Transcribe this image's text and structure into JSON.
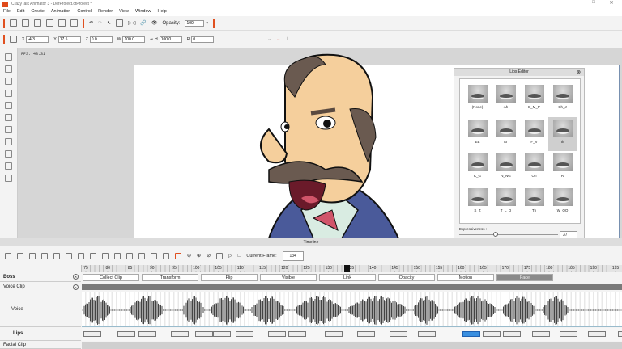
{
  "app": {
    "title": "CrazyTalk Animator 3  - DefProject.ctProject *",
    "fps": "FPS: 43.31"
  },
  "menu": [
    "File",
    "Edit",
    "Create",
    "Animation",
    "Control",
    "Render",
    "View",
    "Window",
    "Help"
  ],
  "toolbar": {
    "opacity_label": "Opacity:",
    "opacity_value": "100"
  },
  "transform": {
    "x_label": "X",
    "x": "-4.3",
    "y_label": "Y",
    "y": "17.5",
    "z_label": "Z",
    "z": "0.0",
    "w_label": "W",
    "w": "100.0",
    "h_label": "H",
    "h": "100.0",
    "r_label": "R",
    "r": "0"
  },
  "lips_editor": {
    "title": "Lips Editor",
    "visemes": [
      "(None)",
      "Ah",
      "B_M_P",
      "Ch_J",
      "EE",
      "Er",
      "F_V",
      "Ih",
      "K_G",
      "N_NG",
      "Oh",
      "R",
      "S_Z",
      "T_L_D",
      "Th",
      "W_OO"
    ],
    "selected": "Ih",
    "expressiveness_label": "Expressiveness :",
    "expressiveness": "37",
    "expressiveness_percent": 37
  },
  "timeline": {
    "title": "Timeline",
    "current_frame_label": "Current Frame:",
    "current_frame": "134",
    "ruler": [
      "75",
      "80",
      "85",
      "90",
      "95",
      "100",
      "105",
      "110",
      "115",
      "120",
      "125",
      "130",
      "135",
      "140",
      "145",
      "150",
      "155",
      "160",
      "165",
      "170",
      "175",
      "180",
      "185",
      "190",
      "195"
    ],
    "tracks": {
      "boss": "Boss",
      "voice_clip": "Voice Clip",
      "voice": "Voice",
      "lips": "Lips",
      "facial_clip": "Facial Clip"
    },
    "boss_buttons": [
      "Collect Clip",
      "Transform",
      "Flip",
      "Visible",
      "Link",
      "Opacity",
      "Motion",
      "Face"
    ],
    "active_button": "Face"
  },
  "colors": {
    "accent": "#e05020",
    "playhead": "#e03020",
    "selected_key": "#3a8fe0"
  }
}
